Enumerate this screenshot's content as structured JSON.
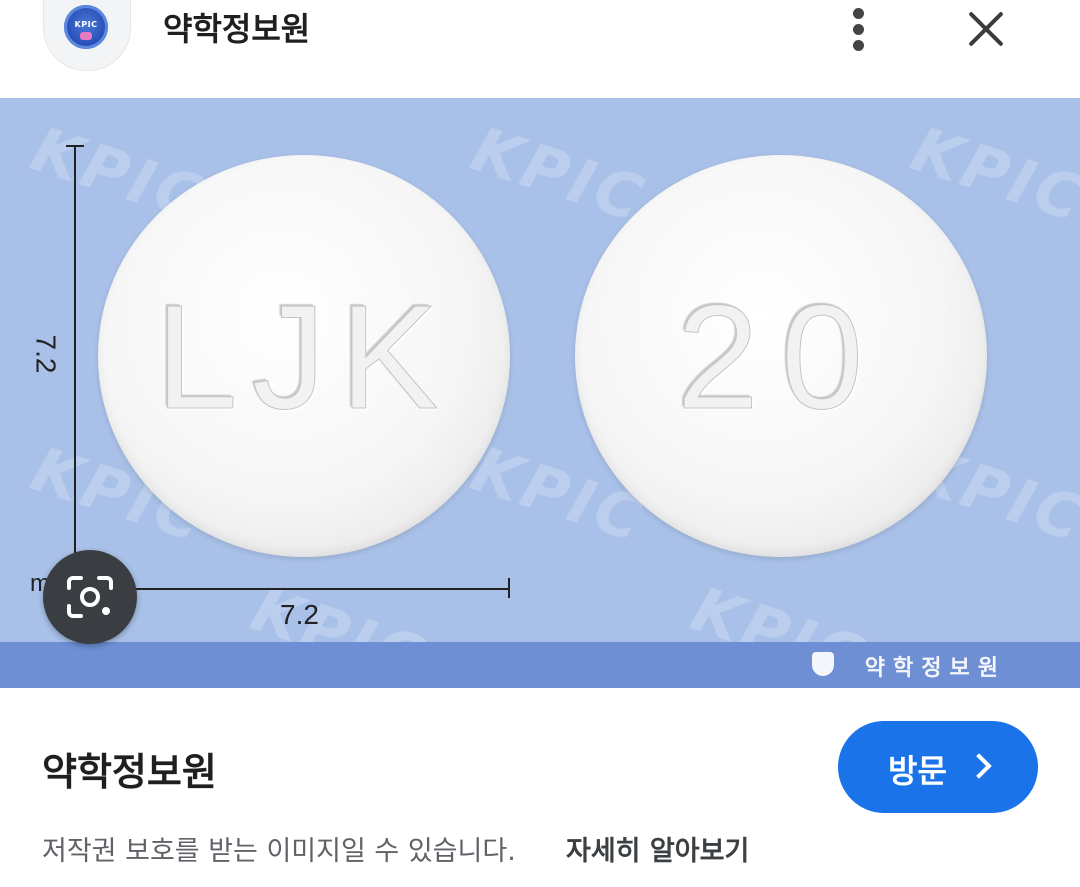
{
  "header": {
    "site_logo_text": "KPIC",
    "title": "약학정보원",
    "more_icon": "more-vertical-icon",
    "close_icon": "close-icon"
  },
  "image": {
    "watermark": "KPIC",
    "tablet_front_imprint": "LJK",
    "tablet_back_imprint": "20",
    "scale_vertical": "7.2",
    "scale_horizontal": "7.2",
    "scale_unit": "mm",
    "banner_text": "약학정보원",
    "background_color": "#a9c1e8",
    "banner_color": "#6e8fd4",
    "lens_icon": "google-lens-icon"
  },
  "footer": {
    "source_title": "약학정보원",
    "visit_label": "방문",
    "visit_color": "#1a73e8",
    "copyright_text": "저작권 보호를 받는 이미지일 수 있습니다.",
    "learn_more": "자세히 알아보기"
  }
}
